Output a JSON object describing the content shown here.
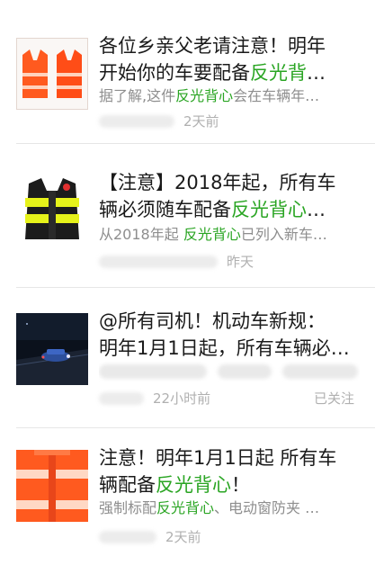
{
  "feed": {
    "items": [
      {
        "title_line1": "各位乡亲父老请注意！明年",
        "title_line2_pre": "开始你的车要配备",
        "title_line2_hl": "反光背",
        "title_line2_post": "…",
        "snippet_pre": "据了解,这件",
        "snippet_hl": "反光背心",
        "snippet_post": "会在车辆年…",
        "time": "2天前"
      },
      {
        "title_line1": "【注意】2018年起，所有车",
        "title_line2_pre": "辆必须随车配备",
        "title_line2_hl": "反光背心",
        "title_line2_post": "…",
        "snippet_pre": "从2018年起 ",
        "snippet_hl": "反光背心",
        "snippet_post": "已列入新车…",
        "time": "昨天"
      },
      {
        "title_line1": "@所有司机！机动车新规：",
        "title_line2_pre": "明年1月1日起，所有车辆必…",
        "title_line2_hl": "",
        "title_line2_post": "",
        "time": "22小时前",
        "followed": "已关注"
      },
      {
        "title_line1": "注意！明年1月1日起 所有车",
        "title_line2_pre": "辆配备",
        "title_line2_hl": "反光背心",
        "title_line2_post": "！",
        "snippet_pre": "强制标配",
        "snippet_hl": "反光背心",
        "snippet_post": "、电动窗防夹 …",
        "time": "2天前"
      }
    ]
  },
  "colors": {
    "highlight": "#2aa523",
    "meta": "#b0b0b0",
    "snippet": "#8e8e8e",
    "vest_orange": "#ff5a1f",
    "vest_yellow": "#e6f21a"
  }
}
